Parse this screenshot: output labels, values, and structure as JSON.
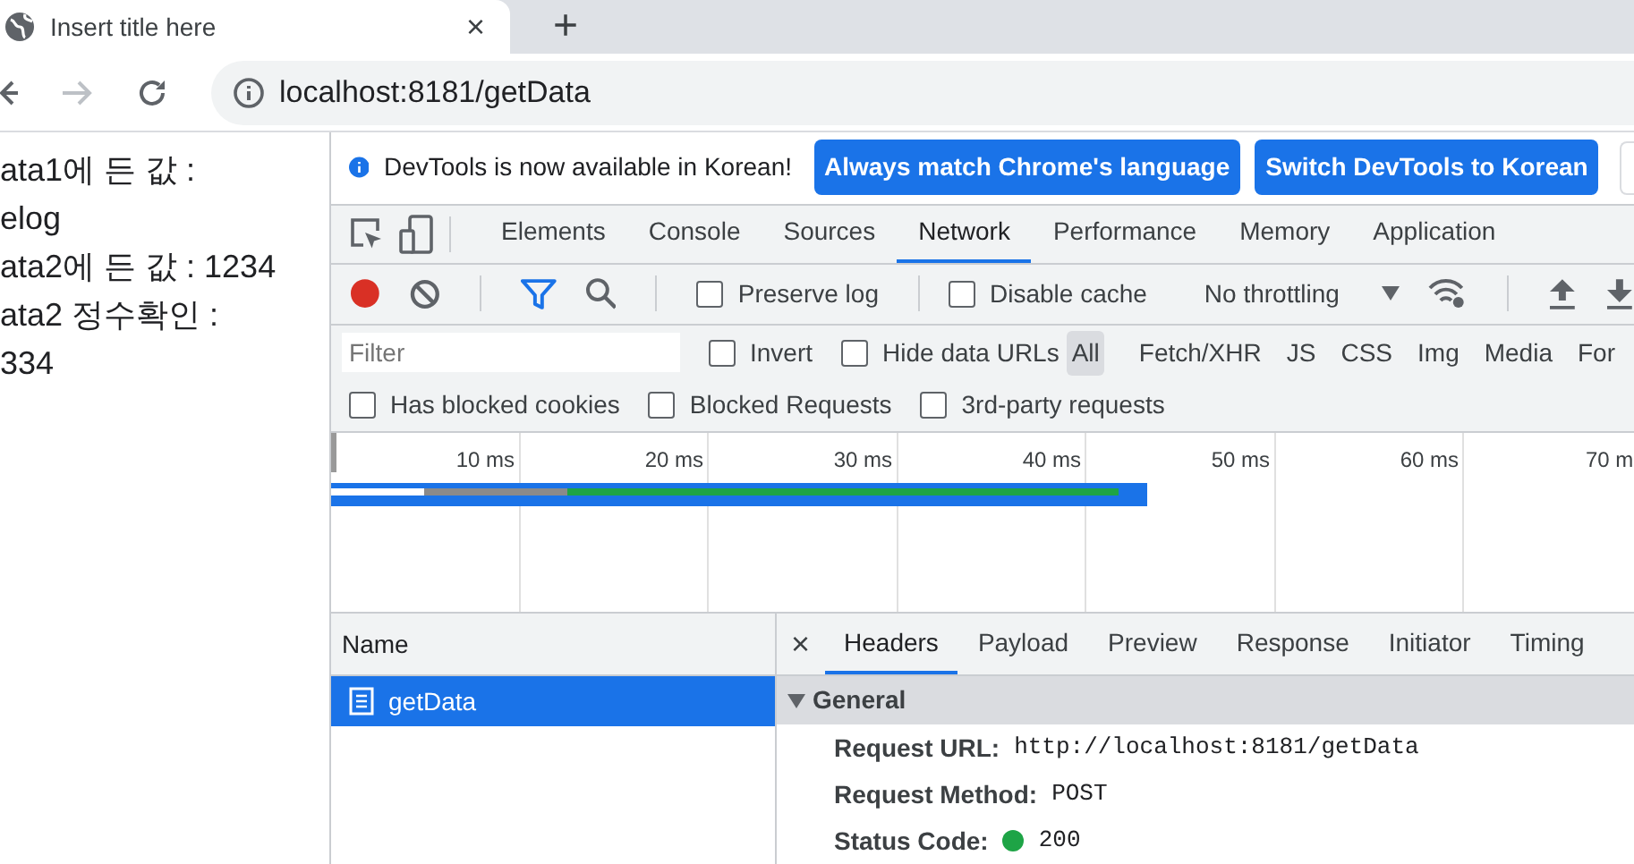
{
  "browser_tab": {
    "title": "Insert title here",
    "close": "×"
  },
  "new_tab": "+",
  "address_bar": {
    "url": "localhost:8181/getData"
  },
  "page": {
    "lines": [
      "ata1에 든 값 :",
      "elog",
      "ata2에 든 값 : 1234",
      "ata2 정수확인 :",
      "334"
    ]
  },
  "devtools": {
    "infobar": {
      "message": "DevTools is now available in Korean!",
      "buttons": [
        "Always match Chrome's language",
        "Switch DevTools to Korean"
      ]
    },
    "tabs": [
      {
        "label": "Elements",
        "selected": false
      },
      {
        "label": "Console",
        "selected": false
      },
      {
        "label": "Sources",
        "selected": false
      },
      {
        "label": "Network",
        "selected": true
      },
      {
        "label": "Performance",
        "selected": false
      },
      {
        "label": "Memory",
        "selected": false
      },
      {
        "label": "Application",
        "selected": false
      }
    ],
    "toolbar": {
      "recording": true,
      "checkboxes": [
        {
          "label": "Preserve log",
          "checked": false
        },
        {
          "label": "Disable cache",
          "checked": false
        }
      ],
      "throttling": "No throttling"
    },
    "filter": {
      "placeholder": "Filter",
      "checkboxes": [
        {
          "label": "Invert",
          "checked": false
        },
        {
          "label": "Hide data URLs",
          "checked": false
        }
      ],
      "types": [
        {
          "label": "All",
          "selected": true
        },
        {
          "label": "Fetch/XHR",
          "selected": false
        },
        {
          "label": "JS",
          "selected": false
        },
        {
          "label": "CSS",
          "selected": false
        },
        {
          "label": "Img",
          "selected": false
        },
        {
          "label": "Media",
          "selected": false
        },
        {
          "label": "For",
          "selected": false
        }
      ]
    },
    "more_filters": [
      {
        "label": "Has blocked cookies",
        "checked": false
      },
      {
        "label": "Blocked Requests",
        "checked": false
      },
      {
        "label": "3rd-party requests",
        "checked": false
      }
    ],
    "overview": {
      "ticks": [
        "10 ms",
        "20 ms",
        "30 ms",
        "40 ms",
        "50 ms",
        "60 ms",
        "70 m"
      ]
    },
    "requests": {
      "column": "Name",
      "rows": [
        {
          "name": "getData",
          "selected": true
        }
      ]
    },
    "details": {
      "close": "×",
      "tabs": [
        {
          "label": "Headers",
          "selected": true
        },
        {
          "label": "Payload",
          "selected": false
        },
        {
          "label": "Preview",
          "selected": false
        },
        {
          "label": "Response",
          "selected": false
        },
        {
          "label": "Initiator",
          "selected": false
        },
        {
          "label": "Timing",
          "selected": false
        }
      ],
      "section": {
        "title": "General",
        "expanded": true,
        "rows": [
          {
            "label": "Request URL:",
            "value": "http://localhost:8181/getData"
          },
          {
            "label": "Request Method:",
            "value": "POST"
          },
          {
            "label": "Status Code:",
            "value": "200"
          }
        ]
      }
    }
  }
}
